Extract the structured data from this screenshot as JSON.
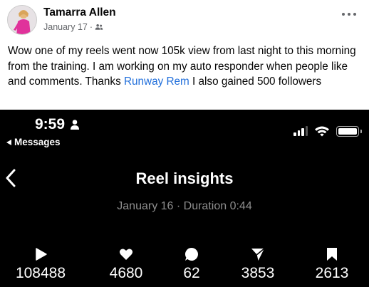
{
  "post": {
    "author": "Tamarra Allen",
    "date": "January 17",
    "separator": "·",
    "privacy_icon": "friends-icon",
    "text_before_link": "Wow one of my reels went now 105k view from last night to this morning from the training. I am working on my auto responder when people like and comments. Thanks ",
    "link_text": "Runway Rem",
    "text_after_link": " I also gained 500 followers",
    "link_color": "#216fdb"
  },
  "phone": {
    "status_time": "9:59",
    "back_app_label": "Messages",
    "battery_level": 1.0,
    "signal_bars": 3,
    "page_title": "Reel insights",
    "subtitle": "January 16 · Duration 0:44",
    "stats": [
      {
        "icon": "play-icon",
        "value": "108488"
      },
      {
        "icon": "heart-icon",
        "value": "4680"
      },
      {
        "icon": "comment-icon",
        "value": "62"
      },
      {
        "icon": "send-icon",
        "value": "3853"
      },
      {
        "icon": "bookmark-icon",
        "value": "2613"
      }
    ]
  }
}
